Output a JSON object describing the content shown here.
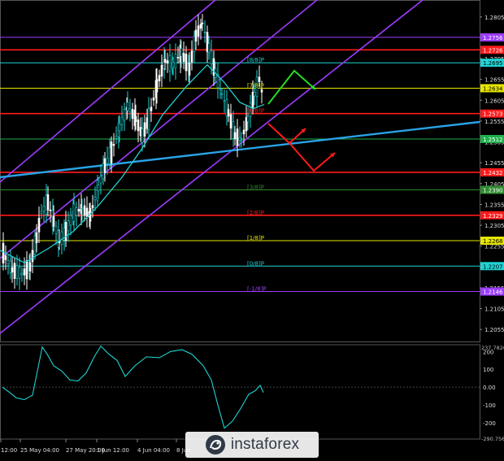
{
  "terminal": {
    "watermark": "instaforex",
    "time_labels": [
      "12:00",
      "25 May 04:00",
      "27 May 20:00",
      "1 Jun 12:00",
      "4 Jun 04:00",
      "8 Jun"
    ],
    "price_axis": {
      "ticks": [
        "1.2805",
        "1.2755",
        "1.2705",
        "1.2655",
        "1.2605",
        "1.2555",
        "1.2505",
        "1.2455",
        "1.2405",
        "1.2355",
        "1.2305",
        "1.2255",
        "1.2205",
        "1.2155",
        "1.2105",
        "1.2055"
      ],
      "marked_levels": [
        {
          "value": "1.2756",
          "color": "#9c3cff"
        },
        {
          "value": "1.2726",
          "color": "#ff1a1a"
        },
        {
          "value": "1.2695",
          "color": "#1fd3d3"
        },
        {
          "value": "1.2634",
          "color": "#e6e600"
        },
        {
          "value": "1.2573",
          "color": "#ff1a1a"
        },
        {
          "value": "1.2512",
          "color": "#1fae4a"
        },
        {
          "value": "1.2432",
          "color": "#ff1a1a"
        },
        {
          "value": "1.2390",
          "color": "#2e8b2e"
        },
        {
          "value": "1.2329",
          "color": "#ff1a1a"
        },
        {
          "value": "1.2268",
          "color": "#e6e600"
        },
        {
          "value": "1.2207",
          "color": "#1fd3d3"
        },
        {
          "value": "1.2146",
          "color": "#9c3cff"
        }
      ]
    },
    "murrey_labels": [
      {
        "text": "[8/8]P",
        "color": "#1fd3d3"
      },
      {
        "text": "[7/8]P",
        "color": "#e6e600"
      },
      {
        "text": "[6/8]P",
        "color": "#ff1a1a"
      },
      {
        "text": "[3/8]P",
        "color": "#2e8b2e"
      },
      {
        "text": "[2/8]P",
        "color": "#ff1a1a"
      },
      {
        "text": "[1/8]P",
        "color": "#e6e600"
      },
      {
        "text": "[0/8]P",
        "color": "#1fd3d3"
      },
      {
        "text": "[-1/8]P",
        "color": "#9c3cff"
      }
    ],
    "indicator_axis": {
      "ticks": [
        "200",
        "100",
        "0.00",
        "-100",
        "-200"
      ],
      "top_value": "237.7826",
      "bottom_value": "-290.7564"
    },
    "colors": {
      "bull_candle": "#1fd3d3",
      "bear_candle": "#ffffff",
      "channel": "#9c3cff",
      "trendline": "#29a3e6",
      "moving_average": "#1fd3d3",
      "arrow_up": "#22dd22",
      "arrow_down": "#ff1a1a"
    }
  }
}
